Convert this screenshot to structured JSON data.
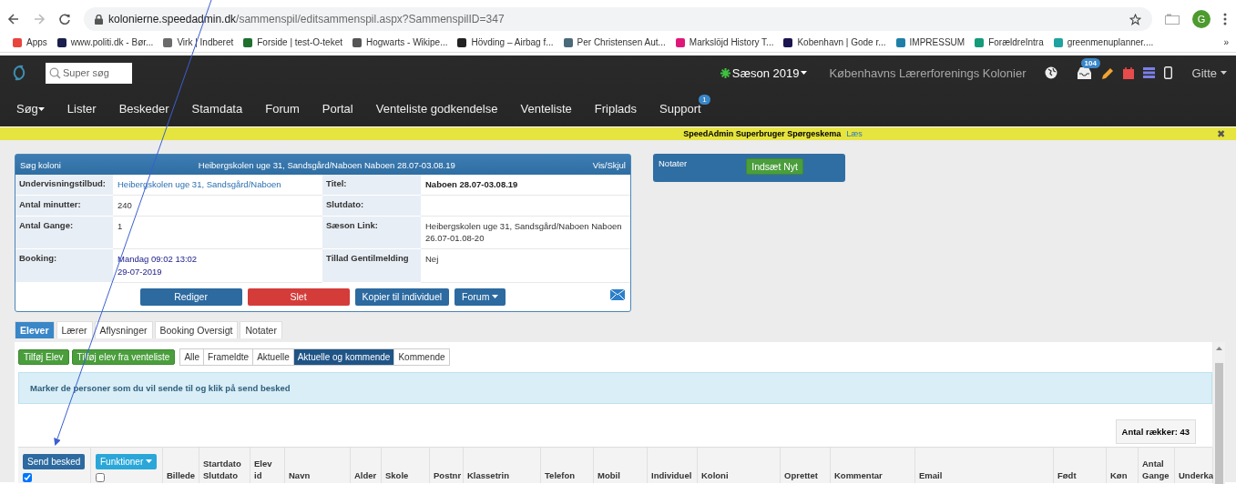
{
  "browser": {
    "url_host": "kolonierne.speedadmin.dk",
    "url_path": "/sammenspil/editsammenspil.aspx?SammenspilID=347",
    "profile": "G",
    "bookmarks": [
      {
        "label": "Apps",
        "color": "#e8453c"
      },
      {
        "label": "www.politi.dk - Bør...",
        "color": "#1a1f4d"
      },
      {
        "label": "Virk | Indberet",
        "color": "#6b6b6b"
      },
      {
        "label": "Forside | test-O-teket",
        "color": "#1f6f2e"
      },
      {
        "label": "Hogwarts - Wikipe...",
        "color": "#555555"
      },
      {
        "label": "Hövding – Airbag f...",
        "color": "#222222"
      },
      {
        "label": "Per Christensen Aut...",
        "color": "#4a6a7a"
      },
      {
        "label": "Markslöjd History T...",
        "color": "#e0177a"
      },
      {
        "label": "Kobenhavn | Gode r...",
        "color": "#1b1450"
      },
      {
        "label": "IMPRESSUM",
        "color": "#1f7fa8"
      },
      {
        "label": "ForældreIntra",
        "color": "#159a7a"
      },
      {
        "label": "greenmenuplanner....",
        "color": "#1fa3a0"
      }
    ],
    "more": "»"
  },
  "navbar": {
    "search_placeholder": "Super søg",
    "season": "Sæson 2019",
    "organization": "Københavns Lærerforenings Kolonier",
    "inbox_count": "104",
    "user": "Gitte",
    "menu": [
      {
        "label": "Søg",
        "dropdown": true
      },
      {
        "label": "Lister",
        "dropdown": false
      },
      {
        "label": "Beskeder",
        "dropdown": false
      },
      {
        "label": "Stamdata",
        "dropdown": false
      },
      {
        "label": "Forum",
        "dropdown": false
      },
      {
        "label": "Portal",
        "dropdown": false
      },
      {
        "label": "Venteliste godkendelse",
        "dropdown": false
      },
      {
        "label": "Venteliste",
        "dropdown": false
      },
      {
        "label": "Friplads",
        "dropdown": false
      },
      {
        "label": "Support",
        "dropdown": false,
        "badge": "1"
      }
    ]
  },
  "notice": {
    "text": "SpeedAdmin Superbruger Spørgeskema",
    "link": "Læs",
    "close": "✖"
  },
  "card": {
    "header_left": "Søg koloni",
    "header_title": "Heibergskolen uge 31, Sandsgård/Naboen Naboen 28.07-03.08.19",
    "header_right": "Vis/Skjul",
    "rows": [
      {
        "cells": [
          {
            "label": "Undervisningstilbud:",
            "value": "Heibergskolen uge 31, Sandsgård/Naboen",
            "kind": "link"
          },
          {
            "label": "Titel:",
            "value": "Naboen 28.07-03.08.19",
            "kind": "bold"
          }
        ]
      },
      {
        "cells": [
          {
            "label": "Antal minutter:",
            "value": "240",
            "kind": "plain"
          },
          {
            "label": "Slutdato:"
          }
        ]
      },
      {
        "cells": [
          {
            "label": "Antal Gange:",
            "value": "1",
            "kind": "plain"
          },
          {
            "label": "Sæson Link:",
            "value": "Heibergskolen uge 31, Sandsgård/Naboen Naboen 26.07-01.08-20",
            "kind": "plain"
          }
        ]
      },
      {
        "cells": [
          {
            "label": "Booking:",
            "value": "Mandag  09:02 13:02\n29-07-2019",
            "kind": "date"
          },
          {
            "label": "Tillad Gentilmelding",
            "value": "Nej",
            "kind": "plain"
          }
        ]
      }
    ],
    "buttons": [
      {
        "label": "Rediger",
        "kind": "primary",
        "dropdown": false
      },
      {
        "label": "Slet",
        "kind": "danger",
        "dropdown": false
      },
      {
        "label": "Kopier til individuel",
        "kind": "primary",
        "dropdown": false
      },
      {
        "label": "Forum",
        "kind": "primary",
        "dropdown": true
      }
    ]
  },
  "notes": {
    "title": "Notater",
    "button": "Indsæt Nyt"
  },
  "tabs": [
    {
      "label": "Elever",
      "selected": true
    },
    {
      "label": "Lærer",
      "selected": false
    },
    {
      "label": "Aflysninger",
      "selected": false
    },
    {
      "label": "Booking Oversigt",
      "selected": false
    },
    {
      "label": "Notater",
      "selected": false
    }
  ],
  "actions": [
    "Tilføj Elev",
    "Tilføj elev fra venteliste"
  ],
  "filters": [
    {
      "label": "Alle",
      "selected": false
    },
    {
      "label": "Frameldte",
      "selected": false
    },
    {
      "label": "Aktuelle",
      "selected": false
    },
    {
      "label": "Aktuelle og kommende",
      "selected": true
    },
    {
      "label": "Kommende",
      "selected": false
    }
  ],
  "alert": "Marker de personer som du vil sende til og klik på send besked",
  "row_count": "Antal rækker: 43",
  "table": {
    "send_button": "Send besked",
    "send_checked": true,
    "functions_button": "Funktioner",
    "functions_checked": false,
    "columns": [
      "Billede",
      "Startdato Slutdato",
      "Elev id",
      "Navn",
      "Alder",
      "Skole",
      "Postnr",
      "Klassetrin",
      "Telefon",
      "Mobil",
      "Individuel",
      "Koloni",
      "Oprettet",
      "Kommentar",
      "Email",
      "Født",
      "Køn",
      "Antal Gange",
      "Underka"
    ]
  }
}
